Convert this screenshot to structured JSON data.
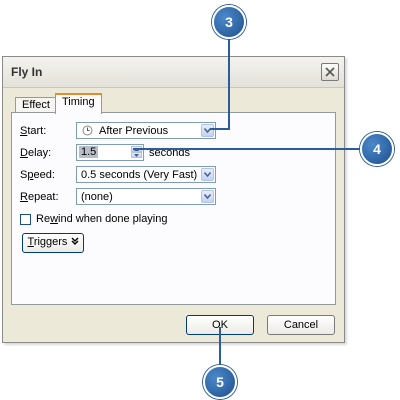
{
  "dialog": {
    "title": "Fly In",
    "tabs": [
      {
        "label": "Effect",
        "active": false
      },
      {
        "label": "Timing",
        "active": true
      }
    ],
    "fields": {
      "start": {
        "label_u": "S",
        "label_rest": "tart:",
        "value": "After Previous"
      },
      "delay": {
        "label_u": "D",
        "label_rest": "elay:",
        "value": "1.5",
        "unit": "seconds"
      },
      "speed": {
        "label_pre": "S",
        "label_u": "p",
        "label_rest": "eed:",
        "value": "0.5 seconds (Very Fast)"
      },
      "repeat": {
        "label_u": "R",
        "label_rest": "epeat:",
        "value": "(none)"
      }
    },
    "rewind": {
      "label_pre": "Re",
      "label_u": "w",
      "label_rest": "ind when done playing",
      "checked": false
    },
    "triggers": {
      "label_u": "T",
      "label_rest": "riggers"
    },
    "ok_label": "OK",
    "cancel_label": "Cancel"
  },
  "callouts": {
    "start": "3",
    "delay": "4",
    "ok": "5"
  },
  "colors": {
    "callout": "#2b5d9a",
    "dialog_bg": "#ece9d8",
    "active_tab_accent": "#e68b2c"
  }
}
